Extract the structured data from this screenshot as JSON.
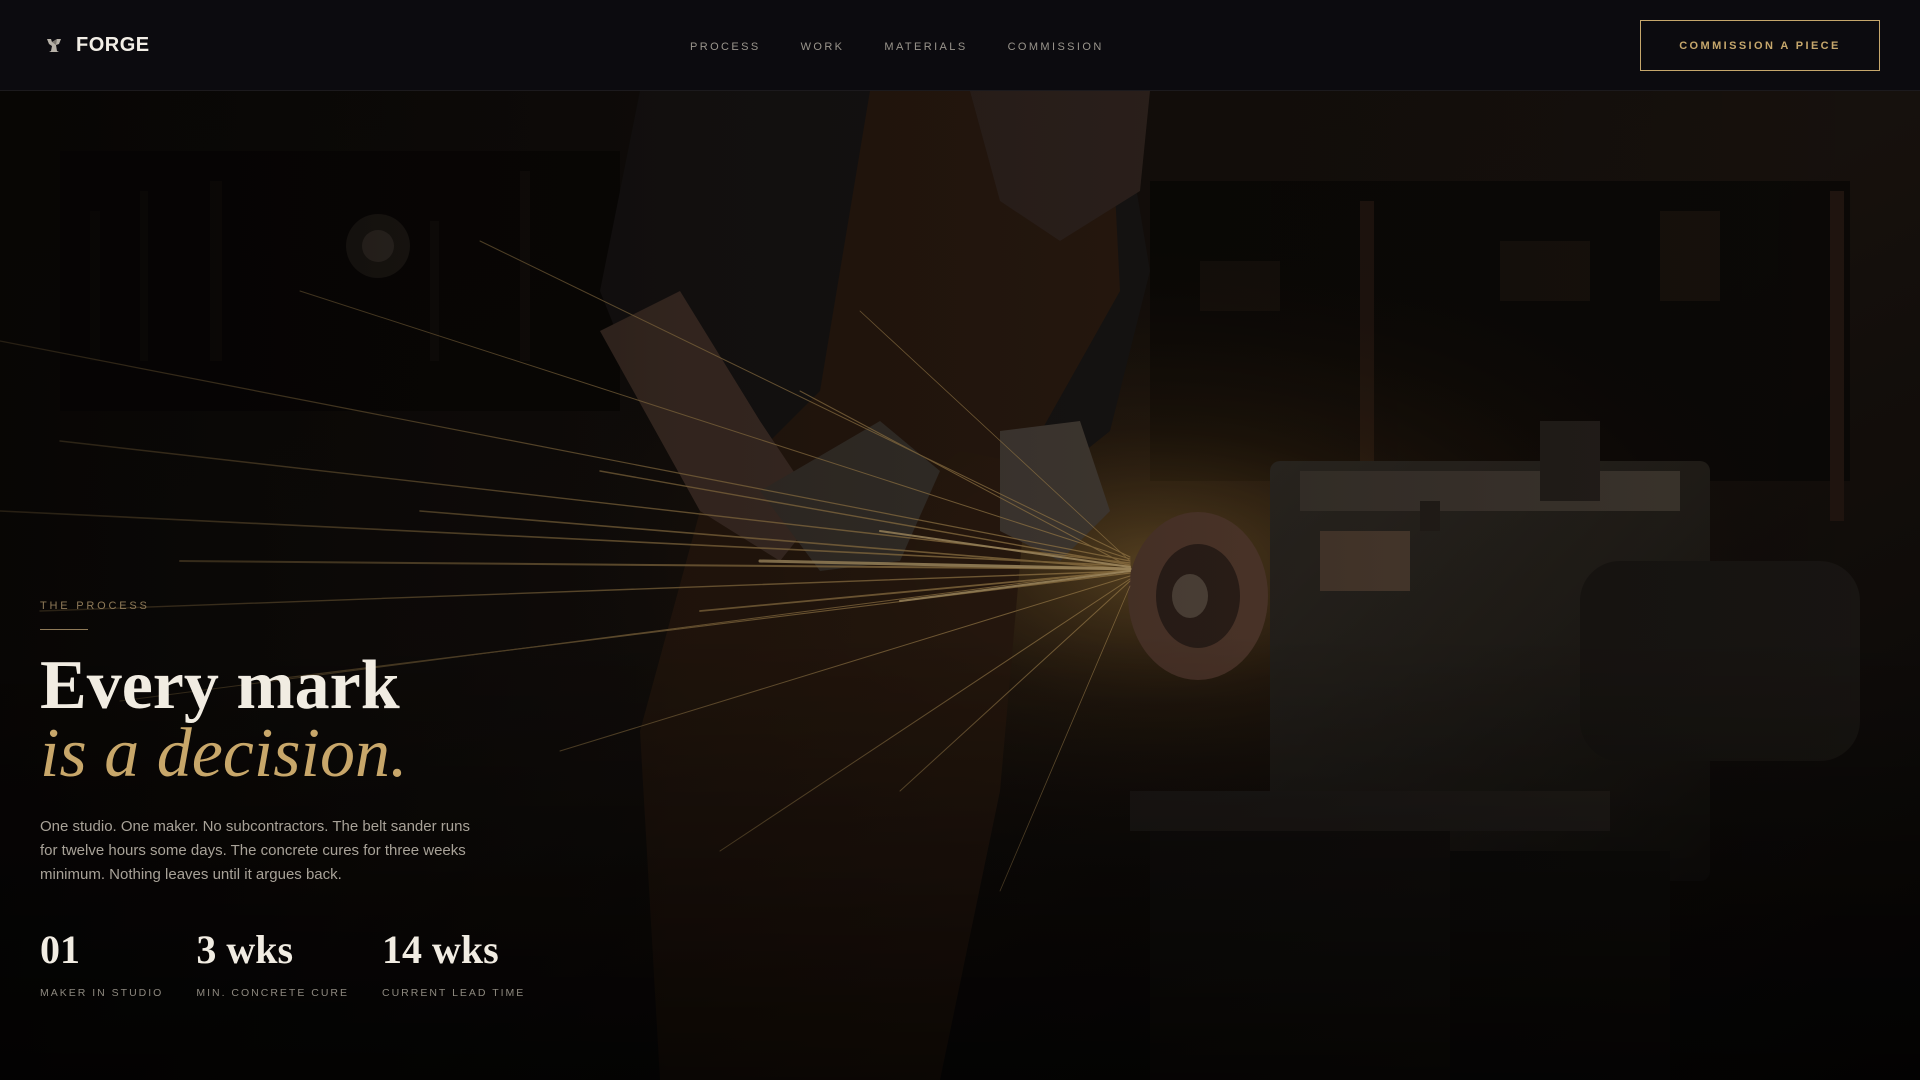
{
  "brand": {
    "name": "FORGE",
    "icon": "anvil-icon"
  },
  "nav": {
    "items": [
      {
        "label": "PROCESS"
      },
      {
        "label": "WORK"
      },
      {
        "label": "MATERIALS"
      },
      {
        "label": "COMMISSION"
      }
    ],
    "cta_label": "COMMISSION A PIECE"
  },
  "hero": {
    "eyebrow": "THE PROCESS",
    "headline_line1": "Every mark",
    "headline_line2": "is a decision.",
    "body": "One studio. One maker. No subcontractors. The belt sander runs for twelve hours some days. The concrete cures for three weeks minimum. Nothing leaves until it argues back.",
    "stats": [
      {
        "value": "01",
        "label": "MAKER IN STUDIO"
      },
      {
        "value": "3 wks",
        "label": "MIN. CONCRETE CURE"
      },
      {
        "value": "14 wks",
        "label": "CURRENT LEAD TIME"
      }
    ]
  },
  "colors": {
    "accent": "#c6a76c",
    "background": "#0c0b0f",
    "text": "#f1ece2"
  }
}
